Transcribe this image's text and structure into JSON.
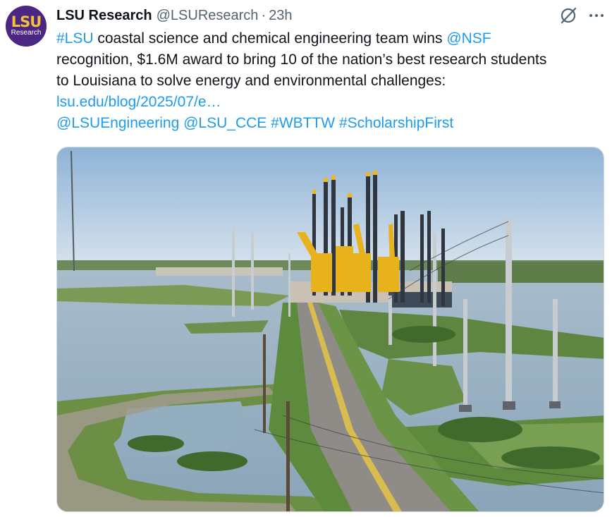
{
  "author": {
    "avatar_logo": "LSU",
    "avatar_subtitle": "Research",
    "name": "LSU Research",
    "handle": "@LSUResearch",
    "separator": "·",
    "time": "23h"
  },
  "icons": [
    "grok-icon",
    "more-icon"
  ],
  "tweet": {
    "hashtag_lsu": "#LSU",
    "text_1": " coastal science and chemical engineering team wins ",
    "mention_nsf": "@NSF",
    "text_2": "recognition, $1.6M award to bring 10 of the nation’s best research students",
    "text_3": "to Louisiana to solve energy and environmental challenges:",
    "link": "lsu.edu/blog/2025/07/e…",
    "tags": [
      "@LSUEngineering",
      "@LSU_CCE",
      "#WBTTW",
      "#ScholarshipFirst"
    ]
  },
  "colors": {
    "link": "#1d9bf0",
    "avatar_bg": "#4b2683",
    "avatar_gold": "#f3c13a",
    "muted": "#536471"
  }
}
